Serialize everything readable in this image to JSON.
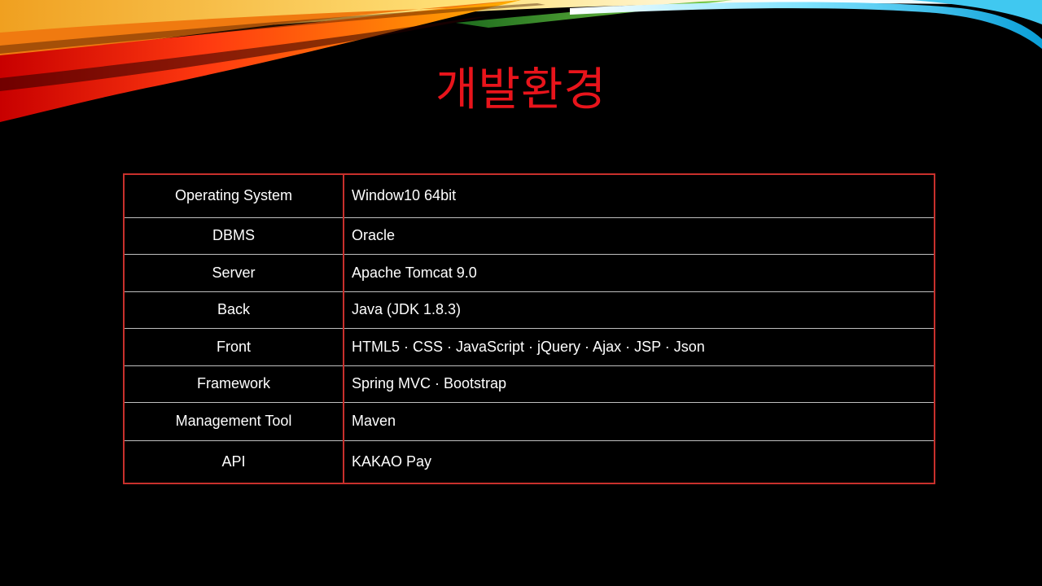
{
  "slide": {
    "title": "개발환경",
    "title_color": "#e8141b",
    "table_border_color": "#c8302c",
    "rows": [
      {
        "label": "Operating System",
        "value": "Window10 64bit"
      },
      {
        "label": "DBMS",
        "value": "Oracle"
      },
      {
        "label": "Server",
        "value": "Apache Tomcat 9.0"
      },
      {
        "label": "Back",
        "value": "Java (JDK 1.8.3)"
      },
      {
        "label": "Front",
        "value": "HTML5 · CSS · JavaScript ·  jQuery · Ajax · JSP · Json"
      },
      {
        "label": "Framework",
        "value": "Spring MVC · Bootstrap"
      },
      {
        "label": "Management Tool",
        "value": "Maven"
      },
      {
        "label": "API",
        "value": "KAKAO Pay"
      }
    ]
  }
}
